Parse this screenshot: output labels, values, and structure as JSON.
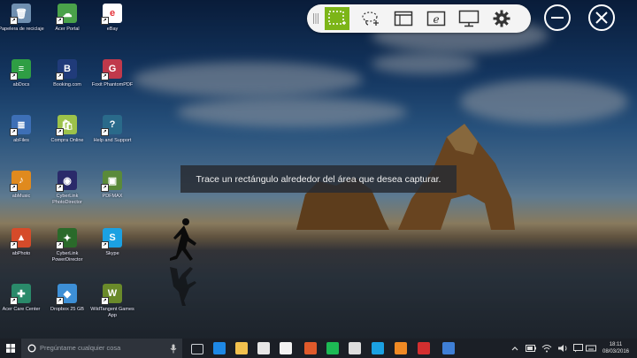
{
  "desktop": {
    "icons": [
      {
        "label": "Papelera de reciclaje",
        "icon": "recycle-bin-icon",
        "color": "#6f8fb0",
        "glyph": "🗑"
      },
      {
        "label": "Acer Portal",
        "icon": "acer-portal-icon",
        "color": "#4aa24a",
        "glyph": "☁"
      },
      {
        "label": "eBay",
        "icon": "ebay-icon",
        "color": "#ffffff",
        "glyph": "e"
      },
      {
        "label": "abDocs",
        "icon": "abdocs-icon",
        "color": "#2f9e44",
        "glyph": "≡"
      },
      {
        "label": "Booking.com",
        "icon": "booking-icon",
        "color": "#203b7a",
        "glyph": "B"
      },
      {
        "label": "Foxit PhantomPDF",
        "icon": "foxit-phantompdf-icon",
        "color": "#c0394b",
        "glyph": "G"
      },
      {
        "label": "abFiles",
        "icon": "abfiles-icon",
        "color": "#3d6fb6",
        "glyph": "≣"
      },
      {
        "label": "Compra Online",
        "icon": "acer-store-icon",
        "color": "#9cc24a",
        "glyph": "🛍"
      },
      {
        "label": "Help and Support",
        "icon": "help-support-icon",
        "color": "#2a6a8a",
        "glyph": "?"
      },
      {
        "label": "abMusic",
        "icon": "abmusic-icon",
        "color": "#e08a1e",
        "glyph": "♪"
      },
      {
        "label": "CyberLink PhotoDirector",
        "icon": "photodirector-icon",
        "color": "#2a2a6a",
        "glyph": "◉"
      },
      {
        "label": "PDFMAX",
        "icon": "pdfmax-icon",
        "color": "#5a8a3a",
        "glyph": "▣"
      },
      {
        "label": "abPhoto",
        "icon": "abphoto-icon",
        "color": "#d64b2a",
        "glyph": "▲"
      },
      {
        "label": "CyberLink PowerDirector",
        "icon": "powerdirector-icon",
        "color": "#2a6a2a",
        "glyph": "✦"
      },
      {
        "label": "Skype",
        "icon": "skype-icon",
        "color": "#1ba1e2",
        "glyph": "S"
      },
      {
        "label": "Acer Care Center",
        "icon": "acer-care-center-icon",
        "color": "#2a8a6a",
        "glyph": "✚"
      },
      {
        "label": "Dropbox 25 GB",
        "icon": "dropbox-icon",
        "color": "#3d8fd6",
        "glyph": "◆"
      },
      {
        "label": "WildTangent Games App",
        "icon": "wildtangent-icon",
        "color": "#6a8a2a",
        "glyph": "W"
      }
    ]
  },
  "snip_toolbar": {
    "tools": [
      {
        "name": "rectangle-capture-button",
        "icon": "rectangle-select-icon",
        "active": true
      },
      {
        "name": "freeform-capture-button",
        "icon": "lasso-add-icon",
        "active": false
      },
      {
        "name": "window-capture-button",
        "icon": "window-icon",
        "active": false
      },
      {
        "name": "web-capture-button",
        "icon": "browser-e-icon",
        "active": false
      },
      {
        "name": "fullscreen-capture-button",
        "icon": "monitor-icon",
        "active": false
      },
      {
        "name": "settings-button",
        "icon": "gear-icon",
        "active": false
      }
    ]
  },
  "hint": {
    "text": "Trace un rectángulo alrededor del área que desea capturar."
  },
  "taskbar": {
    "search_placeholder": "Pregúntame cualquier cosa",
    "apps": [
      {
        "name": "task-view",
        "color": "#cfd3d8"
      },
      {
        "name": "edge",
        "color": "#1e88e5"
      },
      {
        "name": "file-explorer",
        "color": "#f2c14e"
      },
      {
        "name": "store",
        "color": "#e6e6e6"
      },
      {
        "name": "mail",
        "color": "#f2f2f2"
      },
      {
        "name": "media",
        "color": "#e05a2b"
      },
      {
        "name": "spotify",
        "color": "#1db954"
      },
      {
        "name": "home",
        "color": "#dddddd"
      },
      {
        "name": "skype",
        "color": "#1ba1e2"
      },
      {
        "name": "music",
        "color": "#f08a24"
      },
      {
        "name": "app-red",
        "color": "#d32f2f"
      },
      {
        "name": "app-blue",
        "color": "#3f7fd6"
      }
    ],
    "time": "18:11",
    "date": "08/03/2016"
  },
  "colors": {
    "accent": "#7cb518",
    "toolbar_bg": "#f4f4f4",
    "taskbar_bg": "#1b1f26"
  }
}
